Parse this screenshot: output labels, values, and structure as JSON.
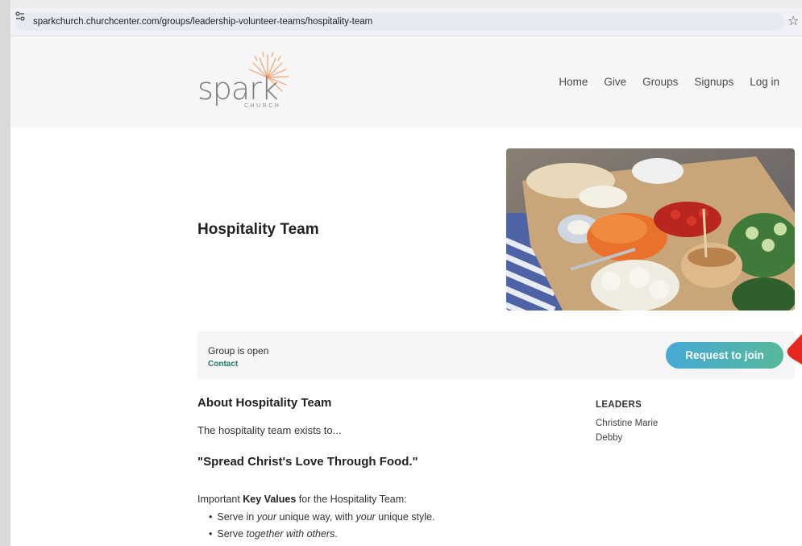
{
  "browser": {
    "url": "sparkchurch.churchcenter.com/groups/leadership-volunteer-teams/hospitality-team",
    "site_info_icon": "tune-icon",
    "bookmark_icon": "star-icon"
  },
  "header": {
    "logo_word": "spark",
    "logo_sub": "CHURCH",
    "nav": [
      "Home",
      "Give",
      "Groups",
      "Signups",
      "Log in"
    ]
  },
  "group": {
    "title": "Hospitality Team",
    "status": "Group is open",
    "contact_label": "Contact",
    "join_label": "Request to join"
  },
  "about": {
    "heading": "About Hospitality Team",
    "intro": "The hospitality team exists to...",
    "quote": "\"Spread Christ's Love Through Food.\"",
    "key_values_prefix": "Important ",
    "key_values_bold": "Key Values",
    "key_values_suffix": " for the Hospitality Team:",
    "bullet1": {
      "a": "Serve in ",
      "b": "your",
      "c": " unique way, with ",
      "d": "your",
      "e": " unique style."
    },
    "bullet2": {
      "a": "Serve ",
      "b": "together with others",
      "c": "."
    }
  },
  "leaders": {
    "heading": "LEADERS",
    "names": [
      "Christine Marie",
      "Debby"
    ]
  },
  "colors": {
    "accent_start": "#45a9d6",
    "accent_end": "#57b89a",
    "contact": "#1f7a6b",
    "logo_rays": "#f2a36b"
  }
}
